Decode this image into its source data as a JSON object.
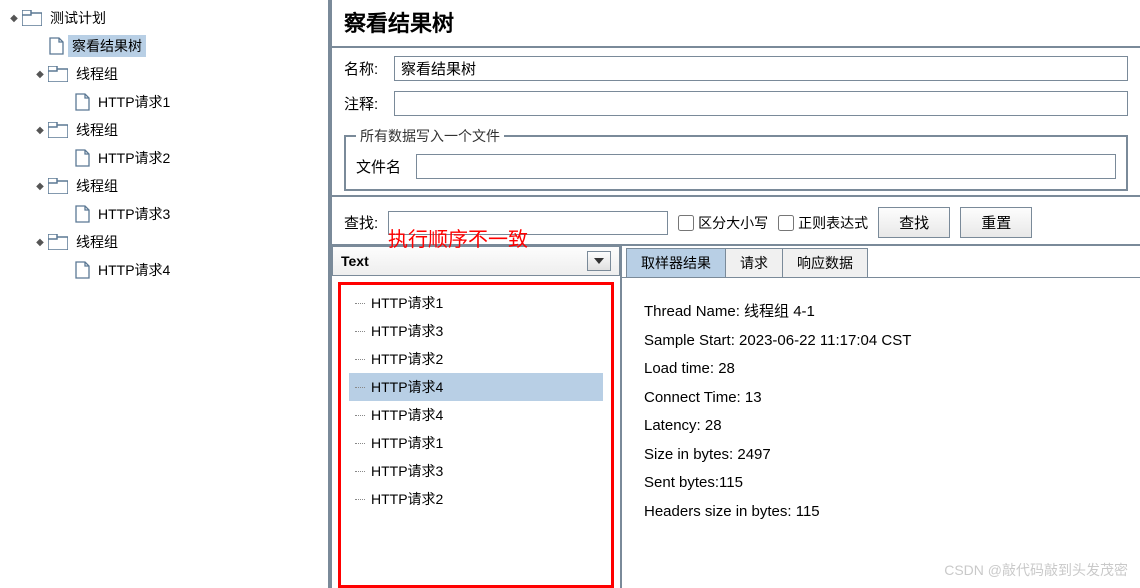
{
  "tree": {
    "root": "测试计划",
    "selected_child": "察看结果树",
    "groups": [
      {
        "name": "线程组",
        "child": "HTTP请求1"
      },
      {
        "name": "线程组",
        "child": "HTTP请求2"
      },
      {
        "name": "线程组",
        "child": "HTTP请求3"
      },
      {
        "name": "线程组",
        "child": "HTTP请求4"
      }
    ]
  },
  "panel": {
    "title": "察看结果树",
    "name_label": "名称:",
    "name_value": "察看结果树",
    "comment_label": "注释:",
    "comment_value": "",
    "file_legend": "所有数据写入一个文件",
    "file_label": "文件名",
    "file_value": ""
  },
  "search": {
    "label": "查找:",
    "value": "",
    "case_label": "区分大小写",
    "regex_label": "正则表达式",
    "find_btn": "查找",
    "reset_btn": "重置"
  },
  "annotation": "执行顺序不一致",
  "results": {
    "dropdown": "Text",
    "items": [
      "HTTP请求1",
      "HTTP请求3",
      "HTTP请求2",
      "HTTP请求4",
      "HTTP请求4",
      "HTTP请求1",
      "HTTP请求3",
      "HTTP请求2"
    ],
    "selected_index": 3
  },
  "tabs": {
    "t1": "取样器结果",
    "t2": "请求",
    "t3": "响应数据"
  },
  "details": {
    "line1": "Thread Name: 线程组 4-1",
    "line2": "Sample Start: 2023-06-22 11:17:04 CST",
    "line3": "Load time: 28",
    "line4": "Connect Time: 13",
    "line5": "Latency: 28",
    "line6": "Size in bytes: 2497",
    "line7": "Sent bytes:115",
    "line8": "Headers size in bytes: 115"
  },
  "watermark": "CSDN @敲代码敲到头发茂密"
}
